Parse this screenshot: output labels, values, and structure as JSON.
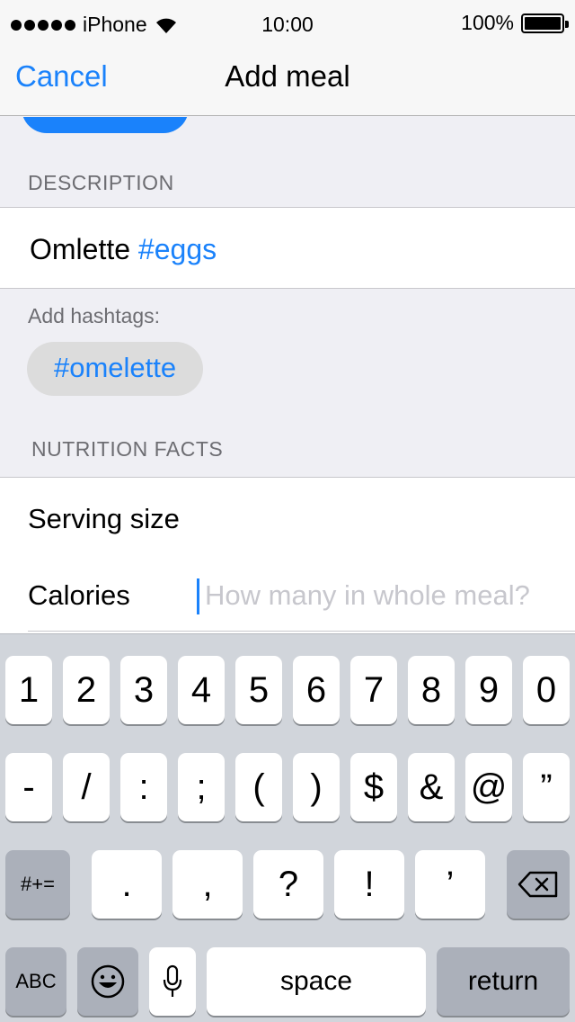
{
  "status_bar": {
    "carrier": "iPhone",
    "time": "10:00",
    "battery_percent": "100%"
  },
  "nav": {
    "cancel_label": "Cancel",
    "title": "Add meal"
  },
  "description": {
    "header": "DESCRIPTION",
    "text": "Omlette",
    "inline_tag": "#eggs"
  },
  "hashtags": {
    "label": "Add hashtags:",
    "suggestion": "#omelette"
  },
  "nutrition": {
    "header": "NUTRITION FACTS",
    "serving_size_label": "Serving size",
    "calories_label": "Calories",
    "calories_placeholder": "How many in whole meal?",
    "calories_value": ""
  },
  "keyboard": {
    "row1": [
      "1",
      "2",
      "3",
      "4",
      "5",
      "6",
      "7",
      "8",
      "9",
      "0"
    ],
    "row2": [
      "-",
      "/",
      ":",
      ";",
      "(",
      ")",
      "$",
      "&",
      "@",
      "”"
    ],
    "row3": [
      ".",
      ",",
      "?",
      "!",
      "’"
    ],
    "mode_symbols_label": "#+=",
    "mode_letters_label": "ABC",
    "space_label": "space",
    "return_label": "return",
    "accent_color": "#1a82fb"
  }
}
